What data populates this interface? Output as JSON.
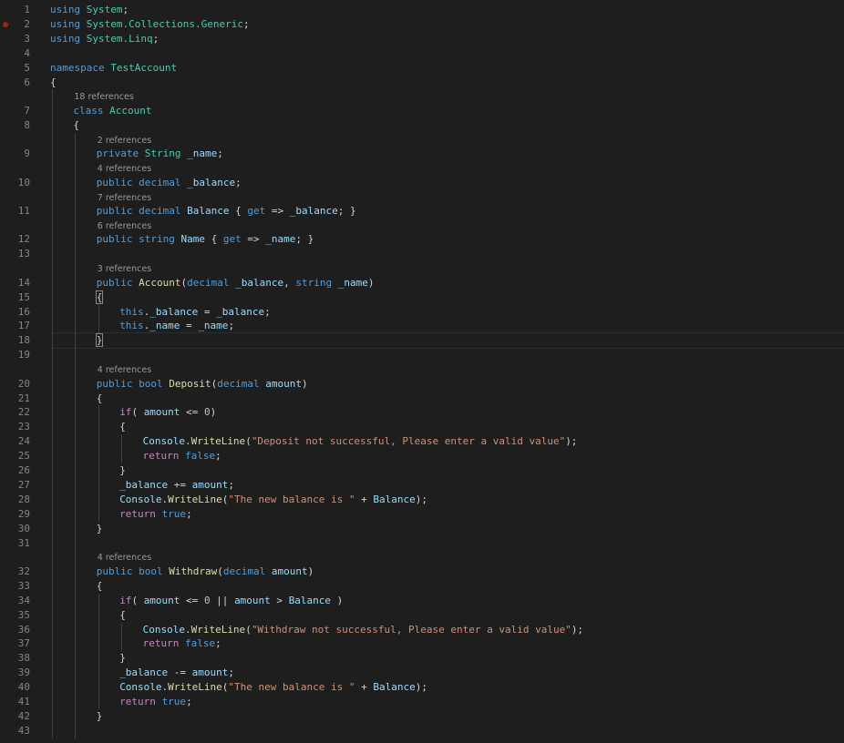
{
  "editor": {
    "language": "csharp",
    "breakpoint_line": 2,
    "current_line": 18,
    "lines": [
      {
        "n": "1",
        "tokens": [
          {
            "t": "using",
            "c": "kw"
          },
          {
            "t": " "
          },
          {
            "t": "System",
            "c": "ns"
          },
          {
            "t": ";"
          }
        ]
      },
      {
        "n": "2",
        "tokens": [
          {
            "t": "using",
            "c": "kw"
          },
          {
            "t": " "
          },
          {
            "t": "System.Collections.Generic",
            "c": "ns"
          },
          {
            "t": ";"
          }
        ]
      },
      {
        "n": "3",
        "tokens": [
          {
            "t": "using",
            "c": "kw"
          },
          {
            "t": " "
          },
          {
            "t": "System.Linq",
            "c": "ns"
          },
          {
            "t": ";"
          }
        ]
      },
      {
        "n": "4",
        "tokens": []
      },
      {
        "n": "5",
        "tokens": [
          {
            "t": "namespace",
            "c": "kw"
          },
          {
            "t": " "
          },
          {
            "t": "TestAccount",
            "c": "ns"
          }
        ]
      },
      {
        "n": "6",
        "tokens": [
          {
            "t": "{"
          }
        ]
      },
      {
        "lens": "18 references",
        "indent": 1
      },
      {
        "n": "7",
        "indent": 1,
        "tokens": [
          {
            "t": "class",
            "c": "kw"
          },
          {
            "t": " "
          },
          {
            "t": "Account",
            "c": "ty"
          }
        ]
      },
      {
        "n": "8",
        "indent": 1,
        "tokens": [
          {
            "t": "{"
          }
        ]
      },
      {
        "lens": "2 references",
        "indent": 2
      },
      {
        "n": "9",
        "indent": 2,
        "tokens": [
          {
            "t": "private",
            "c": "kw"
          },
          {
            "t": " "
          },
          {
            "t": "String",
            "c": "ty"
          },
          {
            "t": " "
          },
          {
            "t": "_name",
            "c": "var"
          },
          {
            "t": ";"
          }
        ]
      },
      {
        "lens": "4 references",
        "indent": 2
      },
      {
        "n": "10",
        "indent": 2,
        "tokens": [
          {
            "t": "public",
            "c": "kw"
          },
          {
            "t": " "
          },
          {
            "t": "decimal",
            "c": "kw"
          },
          {
            "t": " "
          },
          {
            "t": "_balance",
            "c": "var"
          },
          {
            "t": ";"
          }
        ]
      },
      {
        "lens": "7 references",
        "indent": 2
      },
      {
        "n": "11",
        "indent": 2,
        "tokens": [
          {
            "t": "public",
            "c": "kw"
          },
          {
            "t": " "
          },
          {
            "t": "decimal",
            "c": "kw"
          },
          {
            "t": " "
          },
          {
            "t": "Balance",
            "c": "var"
          },
          {
            "t": " { "
          },
          {
            "t": "get",
            "c": "kw"
          },
          {
            "t": " => "
          },
          {
            "t": "_balance",
            "c": "var"
          },
          {
            "t": "; }"
          }
        ]
      },
      {
        "lens": "6 references",
        "indent": 2
      },
      {
        "n": "12",
        "indent": 2,
        "tokens": [
          {
            "t": "public",
            "c": "kw"
          },
          {
            "t": " "
          },
          {
            "t": "string",
            "c": "kw"
          },
          {
            "t": " "
          },
          {
            "t": "Name",
            "c": "var"
          },
          {
            "t": " { "
          },
          {
            "t": "get",
            "c": "kw"
          },
          {
            "t": " => "
          },
          {
            "t": "_name",
            "c": "var"
          },
          {
            "t": "; }"
          }
        ]
      },
      {
        "n": "13",
        "tokens": []
      },
      {
        "lens": "3 references",
        "indent": 2
      },
      {
        "n": "14",
        "indent": 2,
        "tokens": [
          {
            "t": "public",
            "c": "kw"
          },
          {
            "t": " "
          },
          {
            "t": "Account",
            "c": "fn"
          },
          {
            "t": "("
          },
          {
            "t": "decimal",
            "c": "kw"
          },
          {
            "t": " "
          },
          {
            "t": "_balance",
            "c": "var"
          },
          {
            "t": ", "
          },
          {
            "t": "string",
            "c": "kw"
          },
          {
            "t": " "
          },
          {
            "t": "_name",
            "c": "var"
          },
          {
            "t": ")"
          }
        ]
      },
      {
        "n": "15",
        "indent": 2,
        "tokens": [
          {
            "t": "{",
            "c": "brk"
          }
        ]
      },
      {
        "n": "16",
        "indent": 3,
        "tokens": [
          {
            "t": "this",
            "c": "kw"
          },
          {
            "t": "."
          },
          {
            "t": "_balance",
            "c": "var"
          },
          {
            "t": " = "
          },
          {
            "t": "_balance",
            "c": "var"
          },
          {
            "t": ";"
          }
        ]
      },
      {
        "n": "17",
        "indent": 3,
        "tokens": [
          {
            "t": "this",
            "c": "kw"
          },
          {
            "t": "."
          },
          {
            "t": "_name",
            "c": "var"
          },
          {
            "t": " = "
          },
          {
            "t": "_name",
            "c": "var"
          },
          {
            "t": ";"
          }
        ]
      },
      {
        "n": "18",
        "indent": 2,
        "tokens": [
          {
            "t": "}",
            "c": "brk"
          }
        ]
      },
      {
        "n": "19",
        "tokens": []
      },
      {
        "lens": "4 references",
        "indent": 2
      },
      {
        "n": "20",
        "indent": 2,
        "tokens": [
          {
            "t": "public",
            "c": "kw"
          },
          {
            "t": " "
          },
          {
            "t": "bool",
            "c": "kw"
          },
          {
            "t": " "
          },
          {
            "t": "Deposit",
            "c": "fn"
          },
          {
            "t": "("
          },
          {
            "t": "decimal",
            "c": "kw"
          },
          {
            "t": " "
          },
          {
            "t": "amount",
            "c": "var"
          },
          {
            "t": ")"
          }
        ]
      },
      {
        "n": "21",
        "indent": 2,
        "tokens": [
          {
            "t": "{"
          }
        ]
      },
      {
        "n": "22",
        "indent": 3,
        "tokens": [
          {
            "t": "if",
            "c": "ctl"
          },
          {
            "t": "( "
          },
          {
            "t": "amount",
            "c": "var"
          },
          {
            "t": " <= "
          },
          {
            "t": "0",
            "c": "num"
          },
          {
            "t": ")"
          }
        ]
      },
      {
        "n": "23",
        "indent": 3,
        "tokens": [
          {
            "t": "{"
          }
        ]
      },
      {
        "n": "24",
        "indent": 4,
        "tokens": [
          {
            "t": "Console",
            "c": "var"
          },
          {
            "t": "."
          },
          {
            "t": "WriteLine",
            "c": "fn"
          },
          {
            "t": "("
          },
          {
            "t": "\"Deposit not successful, Please enter a valid value\"",
            "c": "str"
          },
          {
            "t": ");"
          }
        ]
      },
      {
        "n": "25",
        "indent": 4,
        "tokens": [
          {
            "t": "return",
            "c": "ctl"
          },
          {
            "t": " "
          },
          {
            "t": "false",
            "c": "kw"
          },
          {
            "t": ";"
          }
        ]
      },
      {
        "n": "26",
        "indent": 3,
        "tokens": [
          {
            "t": "}"
          }
        ]
      },
      {
        "n": "27",
        "indent": 3,
        "tokens": [
          {
            "t": "_balance",
            "c": "var"
          },
          {
            "t": " += "
          },
          {
            "t": "amount",
            "c": "var"
          },
          {
            "t": ";"
          }
        ]
      },
      {
        "n": "28",
        "indent": 3,
        "tokens": [
          {
            "t": "Console",
            "c": "var"
          },
          {
            "t": "."
          },
          {
            "t": "WriteLine",
            "c": "fn"
          },
          {
            "t": "("
          },
          {
            "t": "\"The new balance is \"",
            "c": "str"
          },
          {
            "t": " + "
          },
          {
            "t": "Balance",
            "c": "var"
          },
          {
            "t": ");"
          }
        ]
      },
      {
        "n": "29",
        "indent": 3,
        "tokens": [
          {
            "t": "return",
            "c": "ctl"
          },
          {
            "t": " "
          },
          {
            "t": "true",
            "c": "kw"
          },
          {
            "t": ";"
          }
        ]
      },
      {
        "n": "30",
        "indent": 2,
        "tokens": [
          {
            "t": "}"
          }
        ]
      },
      {
        "n": "31",
        "tokens": []
      },
      {
        "lens": "4 references",
        "indent": 2
      },
      {
        "n": "32",
        "indent": 2,
        "tokens": [
          {
            "t": "public",
            "c": "kw"
          },
          {
            "t": " "
          },
          {
            "t": "bool",
            "c": "kw"
          },
          {
            "t": " "
          },
          {
            "t": "Withdraw",
            "c": "fn"
          },
          {
            "t": "("
          },
          {
            "t": "decimal",
            "c": "kw"
          },
          {
            "t": " "
          },
          {
            "t": "amount",
            "c": "var"
          },
          {
            "t": ")"
          }
        ]
      },
      {
        "n": "33",
        "indent": 2,
        "tokens": [
          {
            "t": "{"
          }
        ]
      },
      {
        "n": "34",
        "indent": 3,
        "tokens": [
          {
            "t": "if",
            "c": "ctl"
          },
          {
            "t": "( "
          },
          {
            "t": "amount",
            "c": "var"
          },
          {
            "t": " <= "
          },
          {
            "t": "0",
            "c": "num"
          },
          {
            "t": " || "
          },
          {
            "t": "amount",
            "c": "var"
          },
          {
            "t": " > "
          },
          {
            "t": "Balance",
            "c": "var"
          },
          {
            "t": " )"
          }
        ]
      },
      {
        "n": "35",
        "indent": 3,
        "tokens": [
          {
            "t": "{"
          }
        ]
      },
      {
        "n": "36",
        "indent": 4,
        "tokens": [
          {
            "t": "Console",
            "c": "var"
          },
          {
            "t": "."
          },
          {
            "t": "WriteLine",
            "c": "fn"
          },
          {
            "t": "("
          },
          {
            "t": "\"Withdraw not successful, Please enter a valid value\"",
            "c": "str"
          },
          {
            "t": ");"
          }
        ]
      },
      {
        "n": "37",
        "indent": 4,
        "tokens": [
          {
            "t": "return",
            "c": "ctl"
          },
          {
            "t": " "
          },
          {
            "t": "false",
            "c": "kw"
          },
          {
            "t": ";"
          }
        ]
      },
      {
        "n": "38",
        "indent": 3,
        "tokens": [
          {
            "t": "}"
          }
        ]
      },
      {
        "n": "39",
        "indent": 3,
        "tokens": [
          {
            "t": "_balance",
            "c": "var"
          },
          {
            "t": " -= "
          },
          {
            "t": "amount",
            "c": "var"
          },
          {
            "t": ";"
          }
        ]
      },
      {
        "n": "40",
        "indent": 3,
        "tokens": [
          {
            "t": "Console",
            "c": "var"
          },
          {
            "t": "."
          },
          {
            "t": "WriteLine",
            "c": "fn"
          },
          {
            "t": "("
          },
          {
            "t": "\"The new balance is \"",
            "c": "str"
          },
          {
            "t": " + "
          },
          {
            "t": "Balance",
            "c": "var"
          },
          {
            "t": ");"
          }
        ]
      },
      {
        "n": "41",
        "indent": 3,
        "tokens": [
          {
            "t": "return",
            "c": "ctl"
          },
          {
            "t": " "
          },
          {
            "t": "true",
            "c": "kw"
          },
          {
            "t": ";"
          }
        ]
      },
      {
        "n": "42",
        "indent": 2,
        "tokens": [
          {
            "t": "}"
          }
        ]
      },
      {
        "n": "43",
        "tokens": []
      }
    ]
  }
}
